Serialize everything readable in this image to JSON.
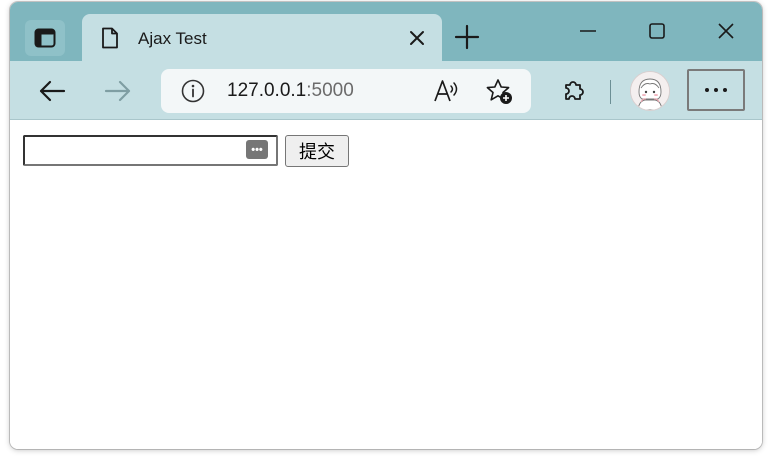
{
  "browser": {
    "tab": {
      "title": "Ajax Test"
    },
    "address_bar": {
      "host": "127.0.0.1",
      "port": ":5000"
    },
    "icons": {
      "tab_actions": "tab-actions-icon",
      "favicon": "page-icon",
      "tab_close": "close-icon",
      "new_tab": "plus-icon",
      "minimize": "minimize-icon",
      "maximize": "maximize-icon",
      "close_window": "close-icon",
      "back": "back-arrow-icon",
      "forward": "forward-arrow-icon",
      "site_info": "info-icon",
      "read_aloud": "read-aloud-icon",
      "add_favorite": "add-favorite-icon",
      "extensions": "puzzle-icon",
      "profile": "avatar",
      "settings_more": "more-icon"
    },
    "colors": {
      "titlebar": "#7fb6be",
      "toolbar": "#c5dfe3",
      "address_bar": "#f3f7f8"
    }
  },
  "page": {
    "password_input": {
      "value": "",
      "reveal_glyph": "•••"
    },
    "submit_button": {
      "label": "提交"
    }
  }
}
